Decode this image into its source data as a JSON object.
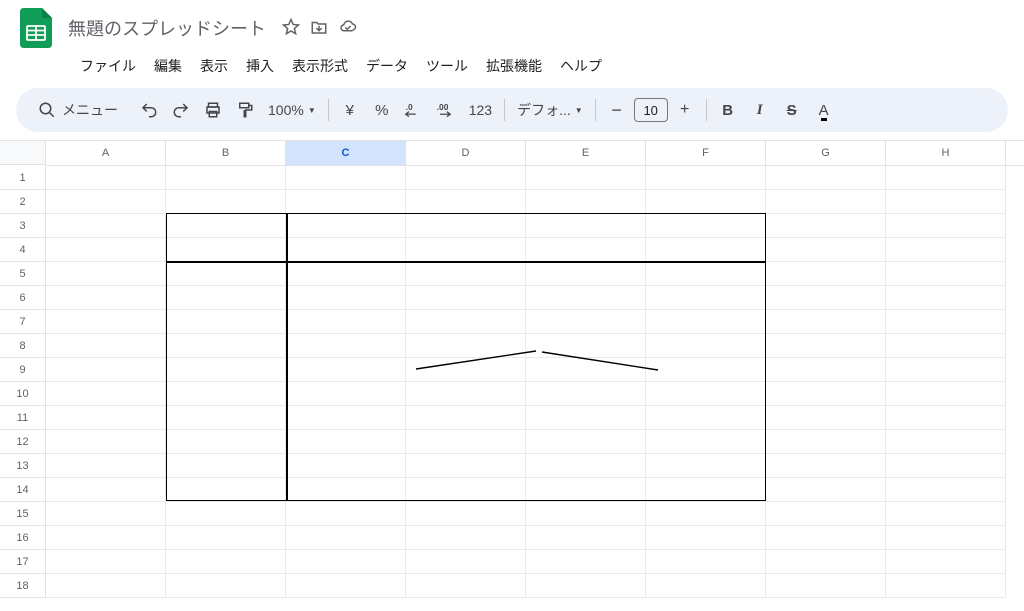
{
  "header": {
    "doc_title": "無題のスプレッドシート"
  },
  "menubar": {
    "file": "ファイル",
    "edit": "編集",
    "view": "表示",
    "insert": "挿入",
    "format": "表示形式",
    "data": "データ",
    "tools": "ツール",
    "extensions": "拡張機能",
    "help": "ヘルプ"
  },
  "toolbar": {
    "search_label": "メニュー",
    "zoom": "100%",
    "currency_symbol": "¥",
    "percent": "%",
    "number_format": "123",
    "font_name": "デフォ...",
    "font_size": "10"
  },
  "grid": {
    "columns": [
      "A",
      "B",
      "C",
      "D",
      "E",
      "F",
      "G",
      "H"
    ],
    "selected_column": "C",
    "rows": [
      1,
      2,
      3,
      4,
      5,
      6,
      7,
      8,
      9,
      10,
      11,
      12,
      13,
      14,
      15,
      16,
      17,
      18
    ]
  }
}
